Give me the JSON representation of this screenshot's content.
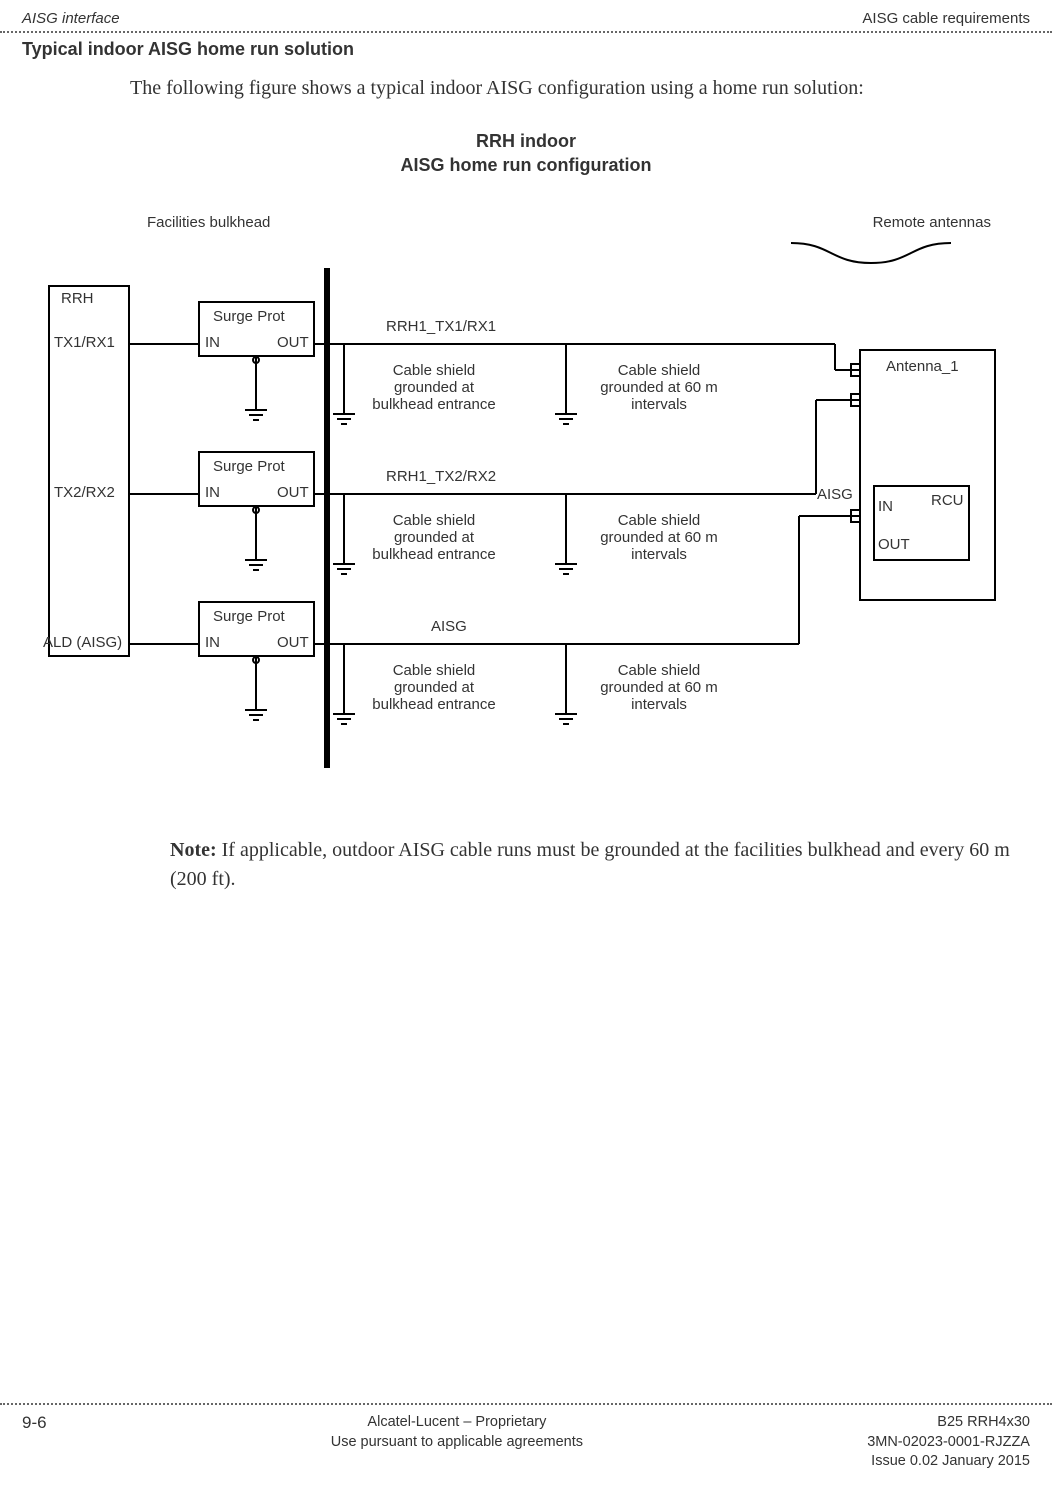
{
  "header": {
    "left": "AISG interface",
    "right": "AISG cable requirements"
  },
  "section": {
    "title": "Typical indoor AISG home run solution",
    "intro": "The following figure shows a typical indoor AISG configuration using a home run solution:"
  },
  "figure": {
    "title_line1": "RRH indoor",
    "title_line2": "AISG home run configuration",
    "labels": {
      "facilities_bulkhead": "Facilities bulkhead",
      "remote_antennas": "Remote antennas",
      "rrh": "RRH",
      "tx1rx1": "TX1/RX1",
      "tx2rx2": "TX2/RX2",
      "ald_aisg": "ALD (AISG)",
      "surge_prot": "Surge Prot",
      "in": "IN",
      "out": "OUT",
      "rrh1_tx1rx1": "RRH1_TX1/RX1",
      "rrh1_tx2rx2": "RRH1_TX2/RX2",
      "aisg_line": "AISG",
      "shield_bulkhead_l1": "Cable shield",
      "shield_bulkhead_l2": "grounded at",
      "shield_bulkhead_l3": "bulkhead entrance",
      "shield_60m_l1": "Cable shield",
      "shield_60m_l2": "grounded at 60 m",
      "shield_60m_l3": "intervals",
      "antenna1": "Antenna_1",
      "aisg_side": "AISG",
      "rcu": "RCU"
    }
  },
  "note": {
    "bold": "Note:",
    "text": " If applicable, outdoor AISG cable runs must be grounded at the facilities bulkhead and every 60 m (200 ft)."
  },
  "footer": {
    "pagenum": "9-6",
    "center_l1": "Alcatel-Lucent – Proprietary",
    "center_l2": "Use pursuant to applicable agreements",
    "right_l1": "B25 RRH4x30",
    "right_l2": "3MN-02023-0001-RJZZA",
    "right_l3": "Issue 0.02   January 2015"
  }
}
